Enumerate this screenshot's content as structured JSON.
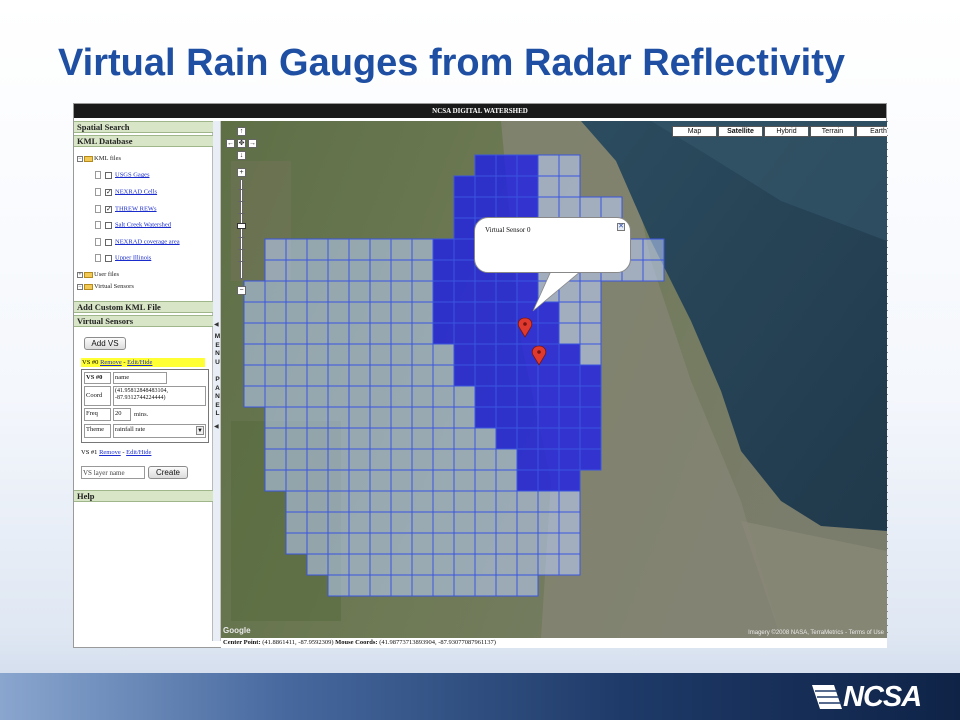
{
  "slide": {
    "title": "Virtual Rain Gauges from Radar Reflectivity",
    "logo": "NCSA"
  },
  "app": {
    "title": "NCSA DIGITAL WATERSHED",
    "sidebar": {
      "spatial_search": "Spatial Search",
      "kml_database": "KML Database",
      "tree": {
        "kml_files": "KML files",
        "items": [
          {
            "label": "USGS Gages",
            "checked": false
          },
          {
            "label": "NEXRAD Cells",
            "checked": true
          },
          {
            "label": "THREW REWs",
            "checked": true
          },
          {
            "label": "Salt Creek Watershed",
            "checked": false
          },
          {
            "label": "NEXRAD coverage area",
            "checked": false
          },
          {
            "label": "Upper Illinois",
            "checked": false
          }
        ],
        "user_files": "User files",
        "virtual_sensors": "Virtual Sensors"
      },
      "add_custom_kml": "Add Custom KML File",
      "virtual_sensors_header": "Virtual Sensors",
      "add_vs_button": "Add VS",
      "vs0": {
        "label": "VS #0",
        "remove": "Remove",
        "edit_hide": "Edit/Hide",
        "sep": " - ",
        "table": {
          "vs_label": "VS #0",
          "name_value": "name",
          "coord_label": "Coord",
          "coord_value": "(41.95812848483104, -87.9312744224444)",
          "freq_label": "Freq",
          "freq_value": "20",
          "freq_unit": "mins.",
          "theme_label": "Theme",
          "theme_value": "rainfall rate"
        }
      },
      "vs1": {
        "label": "VS #1",
        "remove": "Remove",
        "edit_hide": "Edit/Hide",
        "sep": " - "
      },
      "layer_name_placeholder": "VS layer name",
      "create_button": "Create",
      "help": "Help"
    },
    "menu_panel_letters": [
      "M",
      "E",
      "N",
      "U",
      " ",
      "P",
      "A",
      "N",
      "E",
      "L"
    ],
    "map": {
      "types": [
        "Map",
        "Satellite",
        "Hybrid",
        "Terrain",
        "Earth"
      ],
      "active_type": "Satellite",
      "popup_text": "Virtual Sensor 0",
      "attribution": "Imagery ©2008 NASA, TerraMetrics - Terms of Use",
      "google_mark": "Google",
      "nav_icons": [
        "arrow-up-icon",
        "arrow-left-icon",
        "center-icon",
        "arrow-right-icon",
        "arrow-down-icon",
        "zoom-in-icon",
        "zoom-out-icon"
      ]
    },
    "statusbar": {
      "center_label": "Center Point:",
      "center_value": "(41.8861411, -87.9592309)",
      "mouse_label": "Mouse Coords:",
      "mouse_value": "(41.98773713893904, -87.93077087961137)"
    }
  },
  "colors": {
    "title_blue": "#1e4fa2",
    "panel_header": "#d8e5c7",
    "grid_blue": "#3a55e0",
    "highlight_yellow": "#ffff33"
  }
}
